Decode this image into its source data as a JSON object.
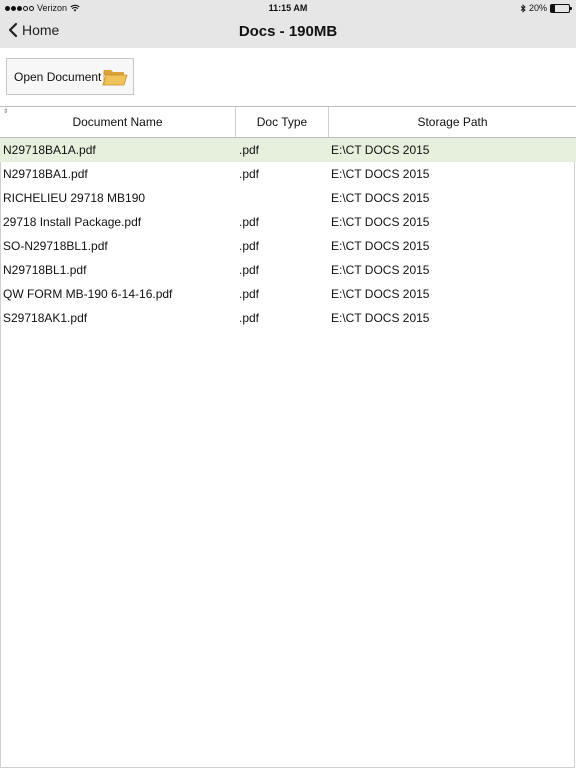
{
  "status_bar": {
    "carrier": "Verizon",
    "time": "11:15 AM",
    "battery_percent": "20%",
    "battery_level": 0.2,
    "signal_bars_filled": 3,
    "signal_bars_total": 5
  },
  "nav": {
    "back_label": "Home",
    "title": "Docs - 190MB"
  },
  "toolbar": {
    "open_document_label": "Open Document"
  },
  "table": {
    "columns": [
      "Document Name",
      "Doc Type",
      "Storage Path"
    ],
    "rows": [
      {
        "name": "N29718BA1A.pdf",
        "type": ".pdf",
        "path": "E:\\CT DOCS 2015",
        "selected": true
      },
      {
        "name": "N29718BA1.pdf",
        "type": ".pdf",
        "path": "E:\\CT DOCS 2015",
        "selected": false
      },
      {
        "name": "RICHELIEU 29718 MB190",
        "type": "",
        "path": "E:\\CT DOCS 2015",
        "selected": false
      },
      {
        "name": "29718 Install Package.pdf",
        "type": ".pdf",
        "path": "E:\\CT DOCS 2015",
        "selected": false
      },
      {
        "name": "SO-N29718BL1.pdf",
        "type": ".pdf",
        "path": "E:\\CT DOCS 2015",
        "selected": false
      },
      {
        "name": "N29718BL1.pdf",
        "type": ".pdf",
        "path": "E:\\CT DOCS 2015",
        "selected": false
      },
      {
        "name": "QW FORM MB-190 6-14-16.pdf",
        "type": ".pdf",
        "path": "E:\\CT DOCS 2015",
        "selected": false
      },
      {
        "name": "S29718AK1.pdf",
        "type": ".pdf",
        "path": "E:\\CT DOCS 2015",
        "selected": false
      }
    ]
  },
  "colors": {
    "nav_background": "#e6e6e6",
    "selected_row": "#e6f0dc",
    "folder_icon": "#e8b84a"
  }
}
